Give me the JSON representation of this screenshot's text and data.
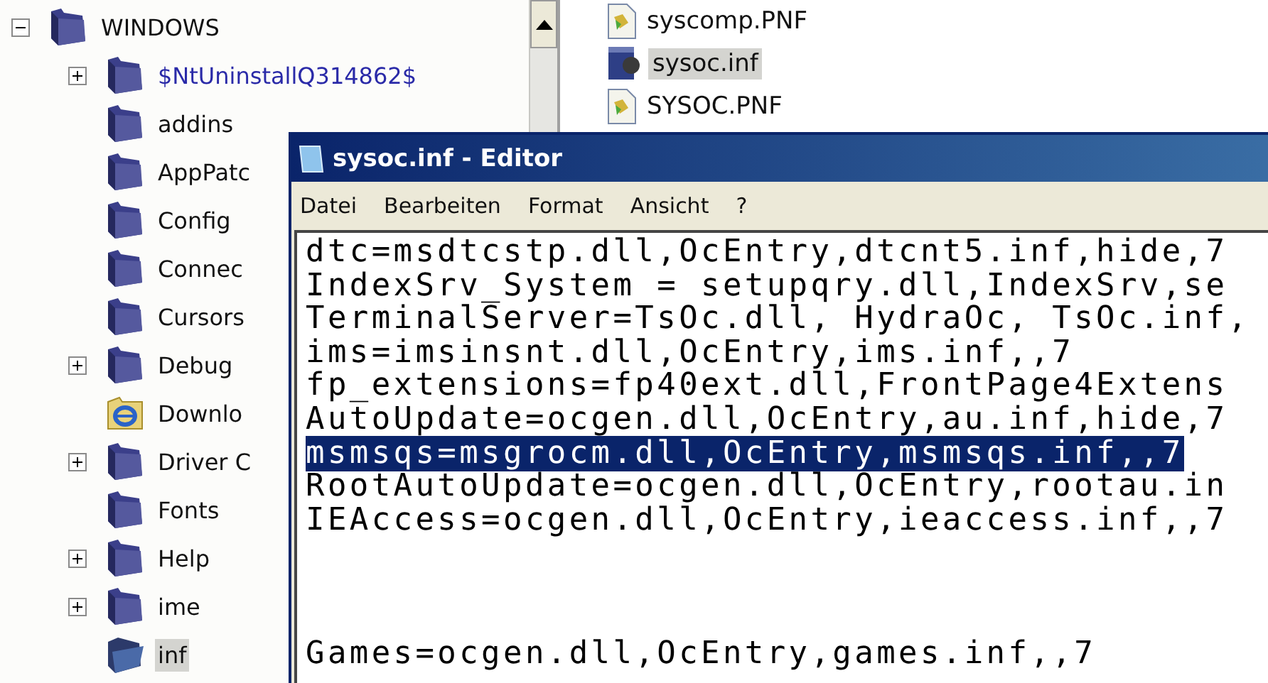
{
  "tree": [
    {
      "label": "WINDOWS",
      "kind": "folder",
      "expanded": true,
      "compressed": false,
      "selected": false,
      "children": [
        {
          "label": "$NtUninstallQ314862$",
          "kind": "folder",
          "expanded": false,
          "compressed": true,
          "selected": false
        },
        {
          "label": "addins",
          "kind": "folder",
          "compressed": false,
          "selected": false
        },
        {
          "label": "AppPatc",
          "kind": "folder",
          "compressed": false,
          "selected": false
        },
        {
          "label": "Config",
          "kind": "folder",
          "compressed": false,
          "selected": false
        },
        {
          "label": "Connec",
          "kind": "folder",
          "compressed": false,
          "selected": false
        },
        {
          "label": "Cursors",
          "kind": "folder",
          "compressed": false,
          "selected": false
        },
        {
          "label": "Debug",
          "kind": "folder",
          "expanded": false,
          "compressed": false,
          "selected": false
        },
        {
          "label": "Downlo",
          "kind": "web-folder",
          "compressed": false,
          "selected": false
        },
        {
          "label": "Driver C",
          "kind": "folder",
          "expanded": false,
          "compressed": false,
          "selected": false
        },
        {
          "label": "Fonts",
          "kind": "folder",
          "compressed": false,
          "selected": false
        },
        {
          "label": "Help",
          "kind": "folder",
          "expanded": false,
          "compressed": false,
          "selected": false
        },
        {
          "label": "ime",
          "kind": "folder",
          "expanded": false,
          "compressed": false,
          "selected": false
        },
        {
          "label": "inf",
          "kind": "open-folder",
          "compressed": false,
          "selected": true
        }
      ]
    }
  ],
  "files": [
    {
      "name": "syscomp.PNF",
      "kind": "pnf",
      "selected": false
    },
    {
      "name": "sysoc.inf",
      "kind": "inf",
      "selected": true
    },
    {
      "name": "SYSOC.PNF",
      "kind": "pnf",
      "selected": false
    }
  ],
  "editor": {
    "title": "sysoc.inf - Editor",
    "menu": [
      "Datei",
      "Bearbeiten",
      "Format",
      "Ansicht",
      "?"
    ],
    "lines": [
      {
        "kind": "text",
        "text": "dtc=msdtcstp.dll,OcEntry,dtcnt5.inf,hide,7",
        "selected": false
      },
      {
        "kind": "text",
        "text": "IndexSrv_System = setupqry.dll,IndexSrv,se",
        "selected": false
      },
      {
        "kind": "text",
        "text": "TerminalServer=TsOc.dll, HydraOc, TsOc.inf,",
        "selected": false
      },
      {
        "kind": "text",
        "text": "ims=imsinsnt.dll,OcEntry,ims.inf,,7",
        "selected": false
      },
      {
        "kind": "text",
        "text": "fp_extensions=fp40ext.dll,FrontPage4Extens",
        "selected": false
      },
      {
        "kind": "text",
        "text": "AutoUpdate=ocgen.dll,OcEntry,au.inf,hide,7",
        "selected": false
      },
      {
        "kind": "text",
        "text": "msmsqs=msgrocm.dll,OcEntry,msmsqs.inf,,7",
        "selected": true
      },
      {
        "kind": "text",
        "text": "RootAutoUpdate=ocgen.dll,OcEntry,rootau.in",
        "selected": false
      },
      {
        "kind": "text",
        "text": "IEAccess=ocgen.dll,OcEntry,ieaccess.inf,,7",
        "selected": false
      },
      {
        "kind": "blank"
      },
      {
        "kind": "blank"
      },
      {
        "kind": "blank"
      },
      {
        "kind": "text",
        "text": "Games=ocgen.dll,OcEntry,games.inf,,7",
        "selected": false
      }
    ]
  }
}
